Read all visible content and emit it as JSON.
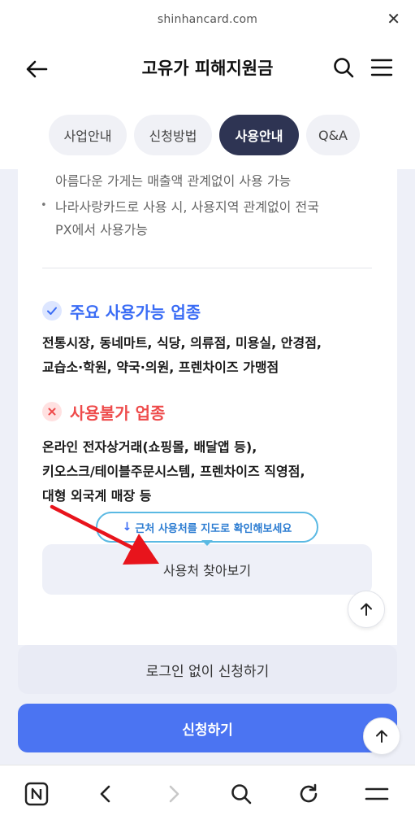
{
  "browser": {
    "url": "shinhancard.com",
    "close_icon": "close-icon"
  },
  "header": {
    "title": "고유가 피해지원금",
    "back_icon": "back-arrow-icon",
    "search_icon": "search-icon",
    "menu_icon": "hamburger-menu-icon"
  },
  "tabs": [
    {
      "label": "사업안내",
      "active": false
    },
    {
      "label": "신청방법",
      "active": false
    },
    {
      "label": "사용안내",
      "active": true
    },
    {
      "label": "Q&A",
      "active": false
    }
  ],
  "content": {
    "top_lines": [
      "아름다운 가게는 매출액 관계없이 사용 가능",
      "나라사랑카드로 사용 시, 사용지역 관계없이 전국",
      "PX에서 사용가능"
    ],
    "allowed": {
      "title": "주요 사용가능 업종",
      "lines": [
        "전통시장, 동네마트, 식당, 의류점, 미용실, 안경점,",
        "교습소·학원, 약국·의원, 프렌차이즈 가맹점"
      ]
    },
    "disallowed": {
      "title": "사용불가 업종",
      "lines": [
        "온라인 전자상거래(쇼핑몰, 배달앱 등),",
        "키오스크/테이블주문시스템, 프렌차이즈 직영점,",
        "대형 외국계 매장 등"
      ]
    },
    "tooltip": "근처 사용처를 지도로 확인해보세요",
    "finder_button": "사용처 찾아보기"
  },
  "buttons": {
    "no_login_apply": "로그인 없이 신청하기",
    "apply": "신청하기"
  },
  "colors": {
    "primary": "#4b74f2",
    "tab_active": "#2e3453",
    "allowed_accent": "#3a6cf5",
    "disallowed_accent": "#ee4b4b",
    "annotation_arrow": "#e8141c"
  }
}
